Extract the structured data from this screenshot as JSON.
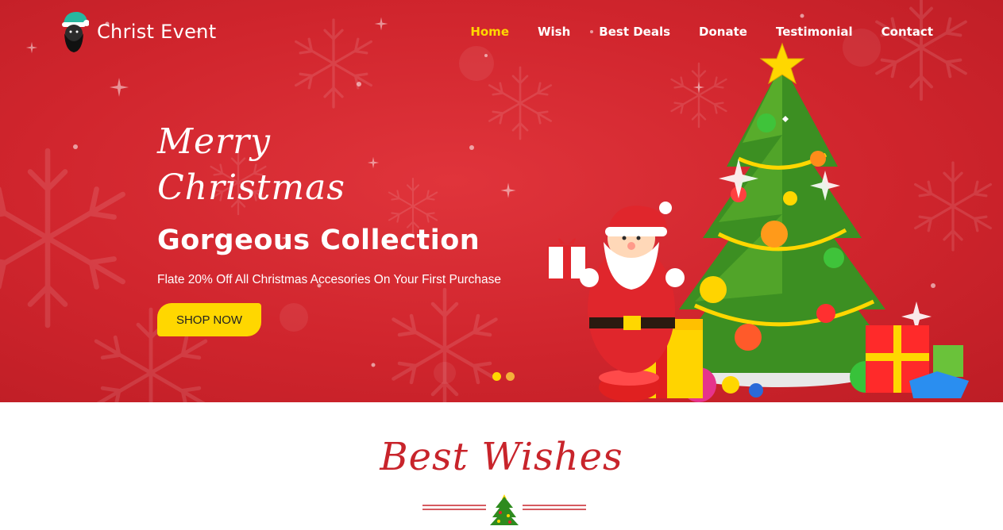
{
  "brand": {
    "name": "Christ Event",
    "logo_icon": "santa-head-icon"
  },
  "nav": {
    "items": [
      {
        "label": "Home",
        "active": true
      },
      {
        "label": "Wish",
        "active": false
      },
      {
        "label": "Best Deals",
        "active": false
      },
      {
        "label": "Donate",
        "active": false
      },
      {
        "label": "Testimonial",
        "active": false
      },
      {
        "label": "Contact",
        "active": false
      }
    ]
  },
  "hero": {
    "script_line1": "Merry",
    "script_line2": "Christmas",
    "title": "Gorgeous Collection",
    "subtitle": "Flate 20% Off All Christmas Accesories On Your First Purchase",
    "cta_label": "SHOP NOW",
    "slides_total": 2,
    "active_slide": 1,
    "art_icon": "santa-christmas-tree-illustration"
  },
  "section": {
    "title": "Best Wishes",
    "divider_icon": "christmas-tree-icon"
  },
  "colors": {
    "hero_red": "#d0252d",
    "accent_yellow": "#ffd700",
    "section_red": "#c8242b",
    "white": "#ffffff"
  }
}
